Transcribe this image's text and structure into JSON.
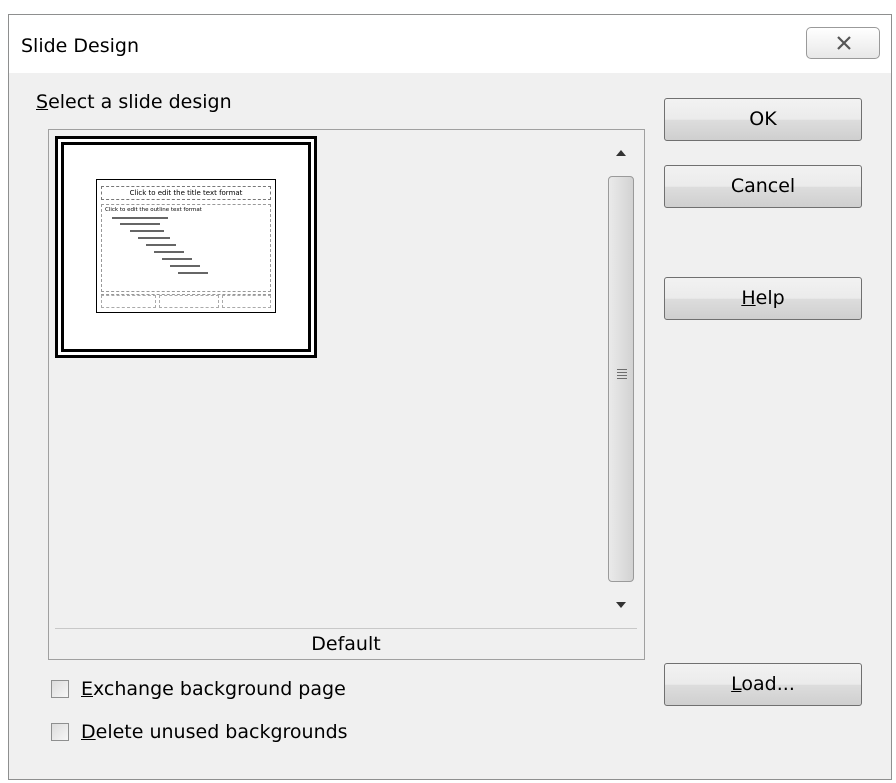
{
  "window": {
    "title": "Slide Design"
  },
  "design_list": {
    "label_prefix": "S",
    "label_rest": "elect a slide design",
    "selected_name": "Default",
    "thumbnail": {
      "title_text": "Click to edit the title text format",
      "outline_text": "Click to edit the outline text format"
    }
  },
  "buttons": {
    "ok": "OK",
    "cancel": "Cancel",
    "help_mnemonic": "H",
    "help_rest": "elp",
    "load_mnemonic": "L",
    "load_rest": "oad..."
  },
  "options": {
    "exchange_mnemonic": "E",
    "exchange_rest": "xchange background page",
    "exchange_checked": false,
    "delete_mnemonic": "D",
    "delete_rest": "elete unused backgrounds",
    "delete_checked": false
  },
  "icons": {
    "close": "close-icon",
    "scroll_up": "arrow-up-icon",
    "scroll_down": "arrow-down-icon",
    "grip": "scroll-grip-icon"
  }
}
